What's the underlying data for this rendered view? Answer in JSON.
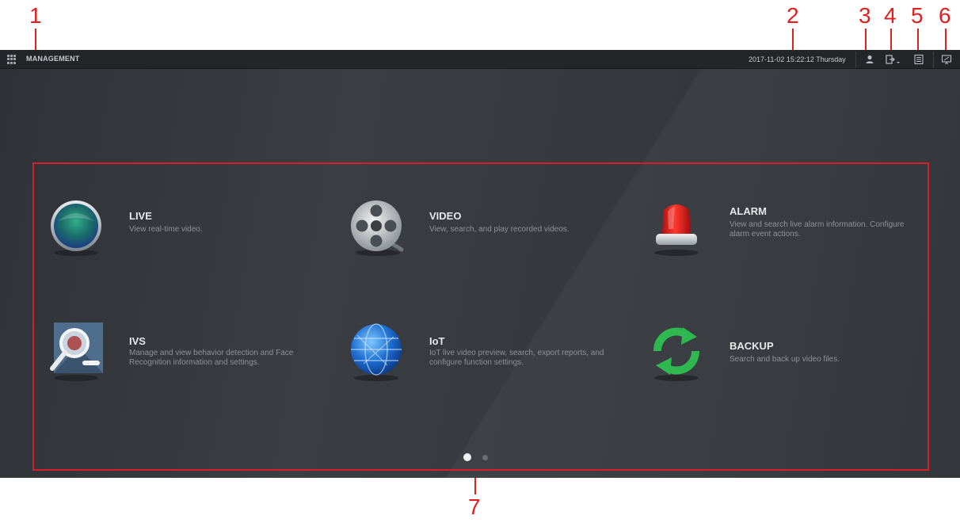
{
  "callouts": [
    "1",
    "2",
    "3",
    "4",
    "5",
    "6",
    "7"
  ],
  "topbar": {
    "title": "MANAGEMENT",
    "datetime": "2017-11-02 15:22:12 Thursday",
    "icons": [
      "grid-menu-icon",
      "user-icon",
      "logout-icon",
      "task-list-icon",
      "display-icon"
    ]
  },
  "modules": [
    {
      "label": "LIVE",
      "desc": "View real-time video.",
      "icon": "live-lens-icon"
    },
    {
      "label": "VIDEO",
      "desc": "View, search, and play recorded videos.",
      "icon": "video-reel-icon"
    },
    {
      "label": "ALARM",
      "desc": "View and search live alarm information. Configure alarm event actions.",
      "icon": "alarm-siren-icon"
    },
    {
      "label": "IVS",
      "desc": "Manage and view behavior detection and Face Recognition information and settings.",
      "icon": "ivs-magnifier-icon"
    },
    {
      "label": "IoT",
      "desc": "IoT live video preview, search, export reports, and configure function settings.",
      "icon": "iot-globe-icon"
    },
    {
      "label": "BACKUP",
      "desc": "Search and back up video files.",
      "icon": "backup-refresh-icon"
    }
  ],
  "pagination": {
    "page_count": 2,
    "current": 1
  },
  "colors": {
    "annotation": "#e02020",
    "frame": "#d4202a",
    "background": "#34373b",
    "topbar": "#232528"
  }
}
